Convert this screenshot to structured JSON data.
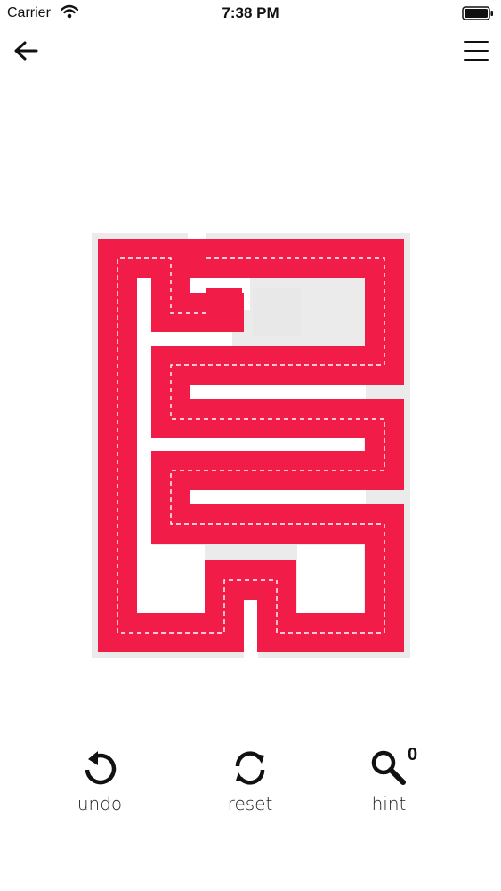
{
  "status_bar": {
    "carrier": "Carrier",
    "time": "7:38 PM"
  },
  "nav": {
    "back_icon": "arrow-left-icon",
    "menu_icon": "hamburger-menu-icon"
  },
  "colors": {
    "path": "#f21c48",
    "track": "#ebebeb",
    "guide": "#ffffff",
    "background": "#ffffff"
  },
  "controls": {
    "undo": {
      "label": "undo",
      "icon": "undo-icon"
    },
    "reset": {
      "label": "reset",
      "icon": "reset-icon"
    },
    "hint": {
      "label": "hint",
      "icon": "magnifier-icon",
      "count": "0"
    }
  }
}
